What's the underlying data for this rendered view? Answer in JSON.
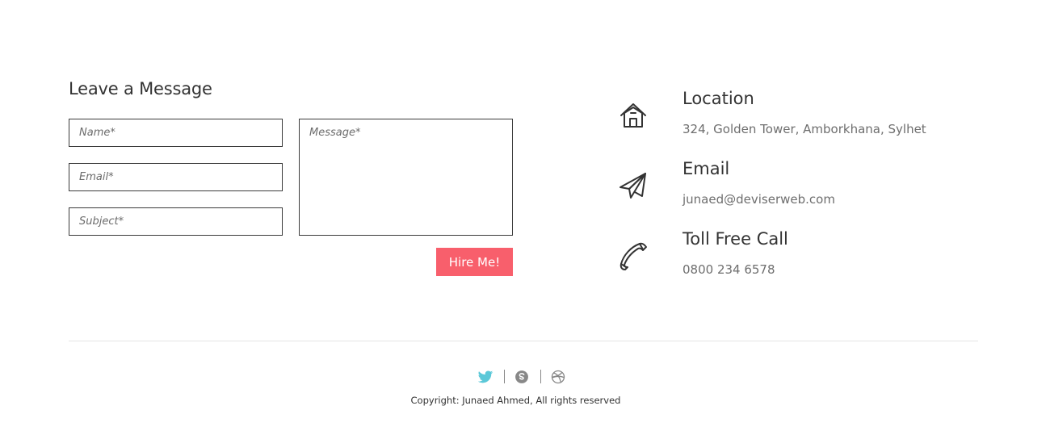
{
  "contact_form": {
    "title": "Leave a Message",
    "name_placeholder": "Name*",
    "email_placeholder": "Email*",
    "subject_placeholder": "Subject*",
    "message_placeholder": "Message*",
    "submit_label": "Hire Me!"
  },
  "contact_info": {
    "location": {
      "title": "Location",
      "text": "324, Golden Tower, Amborkhana, Sylhet",
      "icon": "home-icon"
    },
    "email": {
      "title": "Email",
      "text": "junaed@deviserweb.com",
      "icon": "paper-plane-icon"
    },
    "phone": {
      "title": "Toll Free Call",
      "text": "0800 234 6578",
      "icon": "phone-icon"
    }
  },
  "footer": {
    "social": [
      {
        "icon": "twitter-icon",
        "color": "#5bc8d8"
      },
      {
        "icon": "skype-icon",
        "color": "#888888"
      },
      {
        "icon": "dribbble-icon",
        "color": "#888888"
      }
    ],
    "copyright": "Copyright: Junaed Ahmed, All rights reserved"
  },
  "colors": {
    "accent": "#f85f6c",
    "text": "#333333",
    "muted": "#6e6e6e"
  }
}
